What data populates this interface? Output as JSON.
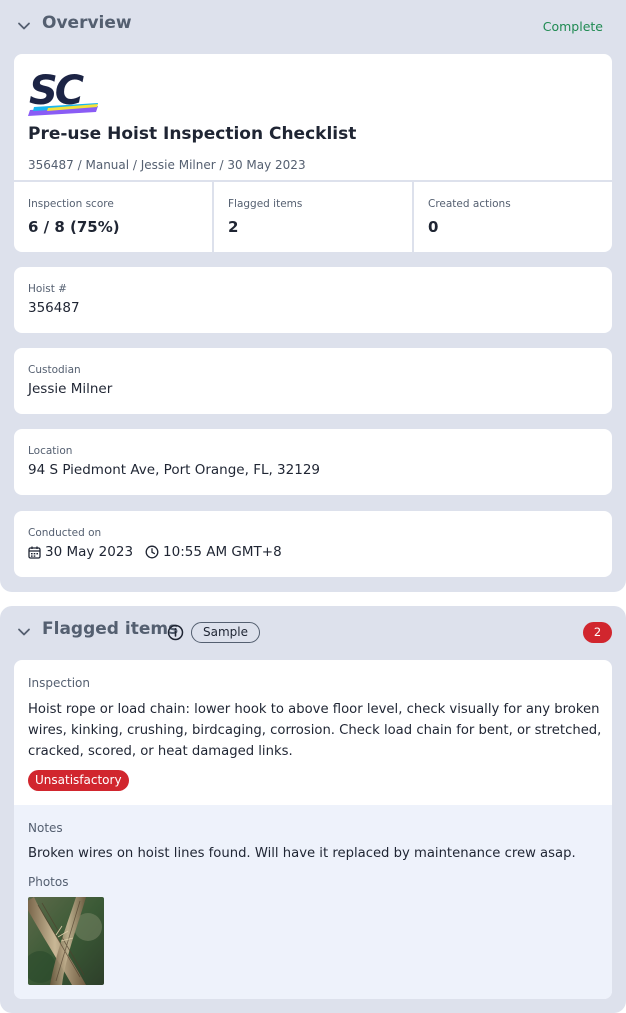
{
  "overview": {
    "title": "Overview",
    "status": "Complete",
    "logo_text": "SC",
    "doc_title": "Pre-use Hoist Inspection Checklist",
    "doc_meta": "356487 / Manual / Jessie Milner / 30 May 2023",
    "stats": [
      {
        "label": "Inspection score",
        "value": "6 / 8 (75%)"
      },
      {
        "label": "Flagged items",
        "value": "2"
      },
      {
        "label": "Created actions",
        "value": "0"
      }
    ],
    "fields": {
      "hoist": {
        "label": "Hoist #",
        "value": "356487"
      },
      "custodian": {
        "label": "Custodian",
        "value": "Jessie Milner"
      },
      "location": {
        "label": "Location",
        "value": "94 S Piedmont Ave, Port Orange, FL, 32129"
      },
      "conducted": {
        "label": "Conducted on",
        "date": "30 May 2023",
        "time": "10:55 AM GMT+8"
      }
    }
  },
  "flagged": {
    "title": "Flagged items",
    "sample_label": "Sample",
    "count": "2",
    "item": {
      "label": "Inspection",
      "text": "Hoist rope or load chain: lower hook to above floor level, check visually for any broken wires, kinking, crushing, birdcaging, corrosion. Check load chain for bent, or stretched, cracked, scored, or heat damaged links.",
      "response": "Unsatisfactory",
      "notes_label": "Notes",
      "notes": "Broken wires on hoist lines found. Will have it replaced by maintenance crew asap.",
      "photos_label": "Photos"
    }
  },
  "icons": {
    "collapse": "chevron-down-icon",
    "info": "info-icon",
    "calendar": "calendar-icon",
    "clock": "clock-icon"
  },
  "colors": {
    "section_bg": "#dde1ec",
    "complete": "#1f8a52",
    "flag_red": "#d1262e",
    "notes_bg": "#eef2fb",
    "logo_navy": "#1c2445"
  }
}
